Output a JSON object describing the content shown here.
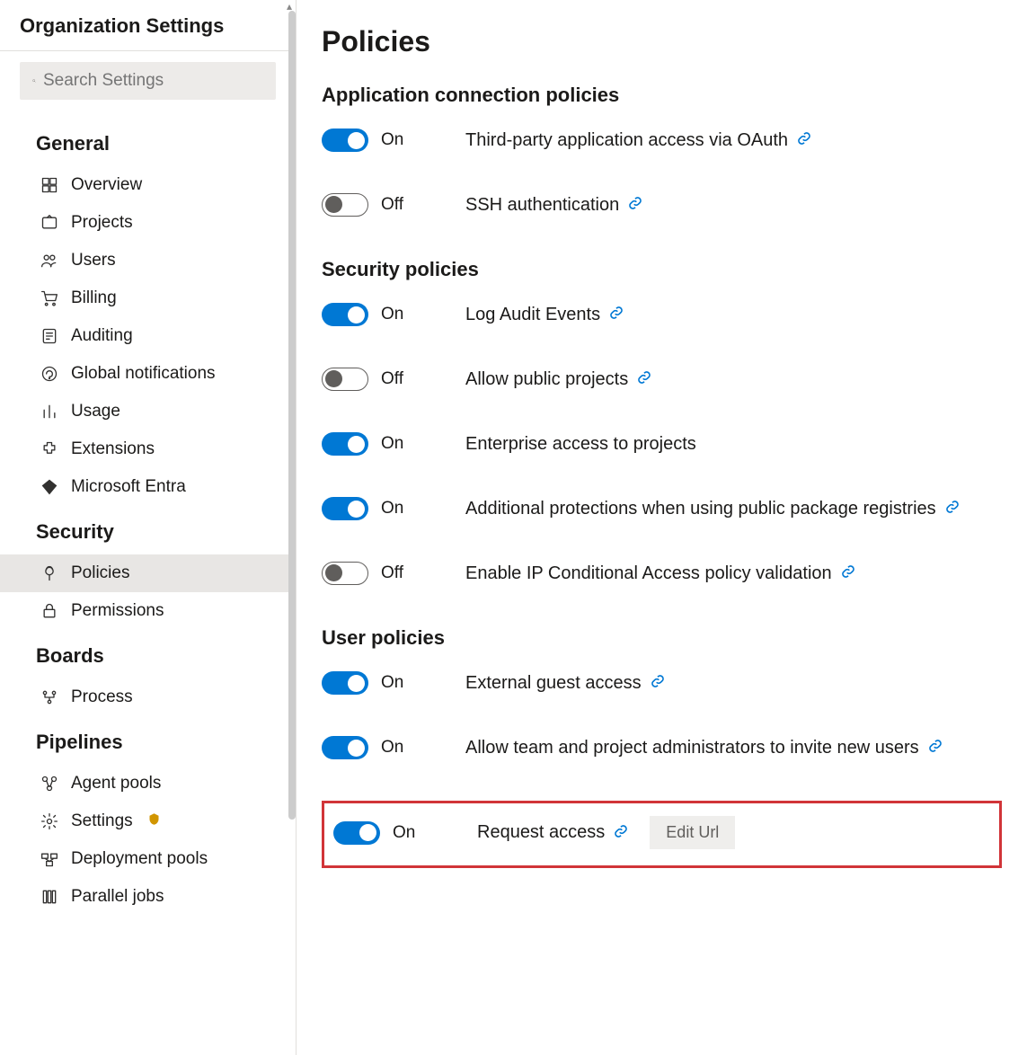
{
  "sidebar": {
    "title": "Organization Settings",
    "search_placeholder": "Search Settings",
    "sections": [
      {
        "header": "General",
        "items": [
          {
            "label": "Overview",
            "icon": "overview",
            "active": false
          },
          {
            "label": "Projects",
            "icon": "projects",
            "active": false
          },
          {
            "label": "Users",
            "icon": "users",
            "active": false
          },
          {
            "label": "Billing",
            "icon": "billing",
            "active": false
          },
          {
            "label": "Auditing",
            "icon": "auditing",
            "active": false
          },
          {
            "label": "Global notifications",
            "icon": "notifications",
            "active": false
          },
          {
            "label": "Usage",
            "icon": "usage",
            "active": false
          },
          {
            "label": "Extensions",
            "icon": "extensions",
            "active": false
          },
          {
            "label": "Microsoft Entra",
            "icon": "entra",
            "active": false
          }
        ]
      },
      {
        "header": "Security",
        "items": [
          {
            "label": "Policies",
            "icon": "policies",
            "active": true
          },
          {
            "label": "Permissions",
            "icon": "permissions",
            "active": false
          }
        ]
      },
      {
        "header": "Boards",
        "items": [
          {
            "label": "Process",
            "icon": "process",
            "active": false
          }
        ]
      },
      {
        "header": "Pipelines",
        "items": [
          {
            "label": "Agent pools",
            "icon": "agentpools",
            "active": false
          },
          {
            "label": "Settings",
            "icon": "settings",
            "active": false,
            "warn": true
          },
          {
            "label": "Deployment pools",
            "icon": "deploymentpools",
            "active": false
          },
          {
            "label": "Parallel jobs",
            "icon": "paralleljobs",
            "active": false
          }
        ]
      }
    ]
  },
  "page": {
    "title": "Policies",
    "groups": [
      {
        "title": "Application connection policies",
        "rows": [
          {
            "on": true,
            "state": "On",
            "label": "Third-party application access via OAuth",
            "link": true
          },
          {
            "on": false,
            "state": "Off",
            "label": "SSH authentication",
            "link": true
          }
        ]
      },
      {
        "title": "Security policies",
        "rows": [
          {
            "on": true,
            "state": "On",
            "label": "Log Audit Events",
            "link": true
          },
          {
            "on": false,
            "state": "Off",
            "label": "Allow public projects",
            "link": true
          },
          {
            "on": true,
            "state": "On",
            "label": "Enterprise access to projects",
            "link": false
          },
          {
            "on": true,
            "state": "On",
            "label": "Additional protections when using public package registries",
            "link": true
          },
          {
            "on": false,
            "state": "Off",
            "label": "Enable IP Conditional Access policy validation",
            "link": true
          }
        ]
      },
      {
        "title": "User policies",
        "rows": [
          {
            "on": true,
            "state": "On",
            "label": "External guest access",
            "link": true
          },
          {
            "on": true,
            "state": "On",
            "label": "Allow team and project administrators to invite new users",
            "link": true
          },
          {
            "on": true,
            "state": "On",
            "label": "Request access",
            "link": true,
            "button": "Edit Url",
            "highlight": true
          }
        ]
      }
    ]
  }
}
